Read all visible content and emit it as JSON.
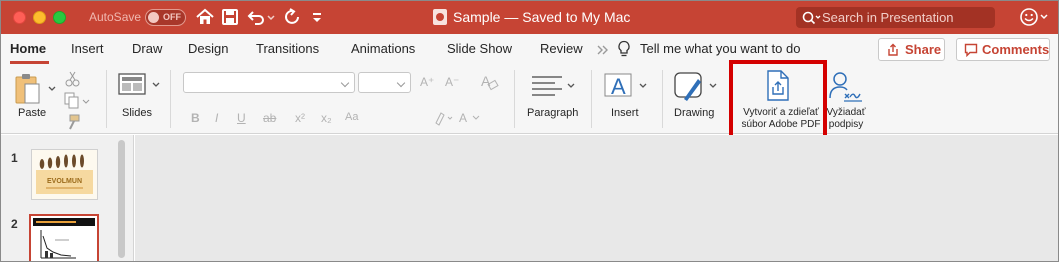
{
  "window": {
    "autosave_label": "AutoSave",
    "autosave_state": "OFF",
    "title": "Sample — Saved to My Mac",
    "search_placeholder": "Search in Presentation"
  },
  "tabs": [
    {
      "label": "Home",
      "active": true
    },
    {
      "label": "Insert"
    },
    {
      "label": "Draw"
    },
    {
      "label": "Design"
    },
    {
      "label": "Transitions"
    },
    {
      "label": "Animations"
    },
    {
      "label": "Slide Show"
    },
    {
      "label": "Review"
    }
  ],
  "tell_me": "Tell me what you want to do",
  "share_label": "Share",
  "comments_label": "Comments",
  "ribbon": {
    "paste": "Paste",
    "slides": "Slides",
    "paragraph": "Paragraph",
    "insert": "Insert",
    "drawing": "Drawing",
    "create_pdf": [
      "Vytvoriť a zdieľať",
      "súbor Adobe PDF"
    ],
    "request_sign": [
      "Vyžiadať",
      "podpisy"
    ]
  },
  "slides": [
    {
      "number": "1",
      "title_text": "EVOLMUN"
    },
    {
      "number": "2",
      "title_text": ""
    }
  ],
  "colors": {
    "titlebar": "#c64434",
    "accent": "#c64434",
    "highlight": "#d40000",
    "pdf_icon": "#2f6fb8"
  }
}
